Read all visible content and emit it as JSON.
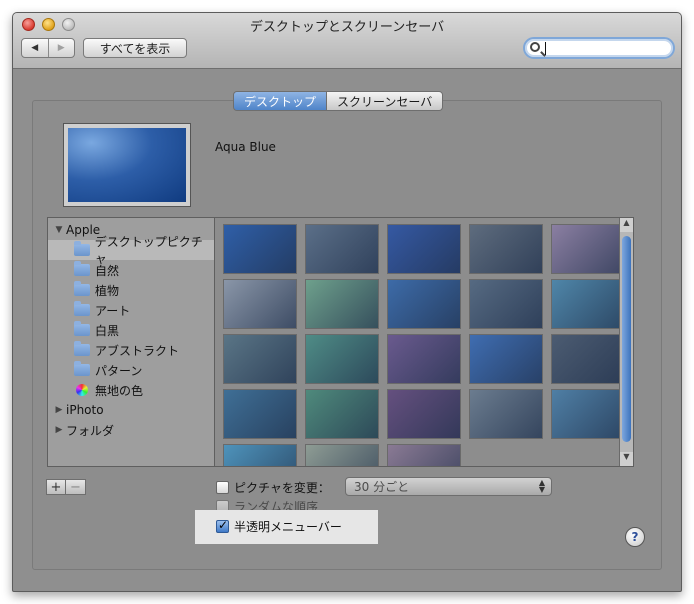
{
  "window": {
    "title": "デスクトップとスクリーンセーバ"
  },
  "toolbar": {
    "show_all_label": "すべてを表示",
    "back_icon": "◀",
    "forward_icon": "▶",
    "search_placeholder": ""
  },
  "tabs": [
    {
      "label": "デスクトップ",
      "active": true
    },
    {
      "label": "スクリーンセーバ",
      "active": false
    }
  ],
  "current_picture": {
    "name": "Aqua Blue"
  },
  "sidebar": {
    "items": [
      {
        "label": "Apple",
        "level": 0,
        "disclosure": "▼"
      },
      {
        "label": "デスクトップピクチャ",
        "level": 1,
        "selected": true
      },
      {
        "label": "自然",
        "level": 1
      },
      {
        "label": "植物",
        "level": 1
      },
      {
        "label": "アート",
        "level": 1
      },
      {
        "label": "白黒",
        "level": 1
      },
      {
        "label": "アブストラクト",
        "level": 1
      },
      {
        "label": "パターン",
        "level": 1
      },
      {
        "label": "無地の色",
        "level": 1
      },
      {
        "label": "iPhoto",
        "level": 0,
        "disclosure": "▶"
      },
      {
        "label": "フォルダ",
        "level": 0,
        "disclosure": "▶"
      }
    ]
  },
  "thumbnails": [
    "#2f5fa8",
    "#5b6f88",
    "#3559a3",
    "#5e6c7e",
    "#8b7fa2",
    "#8a96a8",
    "#6ea08c",
    "#3d6ba8",
    "#566a82",
    "#4f86a9",
    "#5a7586",
    "#4f8c86",
    "#6a5a8e",
    "#3f6db1",
    "#4c5c72",
    "#3f6f96",
    "#4f8a7c",
    "#65507f",
    "#6b7c8f",
    "#4f7fa5",
    "#4e93bb",
    "#8e9c94",
    "#8a7a94"
  ],
  "controls": {
    "plus_label": "+",
    "minus_label": "−",
    "change_picture_label": "ピクチャを変更：",
    "change_picture_checked": false,
    "interval_value": "30 分ごと",
    "random_order_label": "ランダムな順序",
    "random_order_checked": false,
    "translucent_menu_label": "半透明メニューバー",
    "translucent_menu_checked": true,
    "help_label": "?"
  }
}
